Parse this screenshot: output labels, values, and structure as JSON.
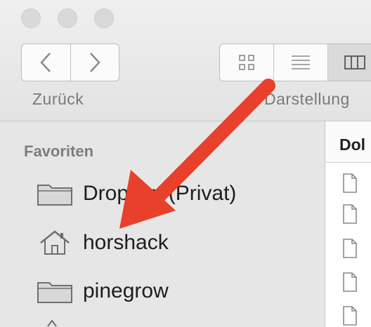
{
  "toolbar": {
    "back_label": "Zurück",
    "view_label": "Darstellung"
  },
  "sidebar": {
    "section_title": "Favoriten",
    "items": [
      {
        "label": "Dropbox (Privat)",
        "icon": "folder-icon"
      },
      {
        "label": "horshack",
        "icon": "home-icon"
      },
      {
        "label": "pinegrow",
        "icon": "folder-icon"
      }
    ]
  },
  "filepane": {
    "column_header": "Dol"
  },
  "annotation": {
    "arrow_color": "#e8402a"
  }
}
